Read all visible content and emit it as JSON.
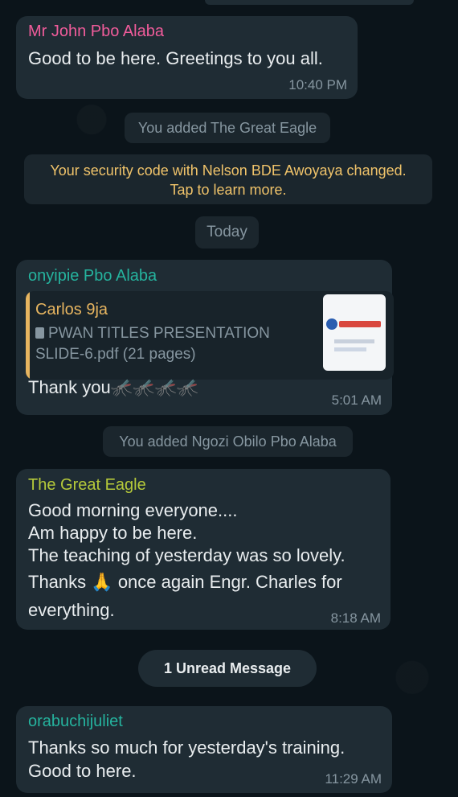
{
  "messages": {
    "m1": {
      "sender": "Mr John Pbo Alaba",
      "sender_color": "#f15c9b",
      "text": "Good to be here.  Greetings to you all.",
      "time": "10:40 PM"
    },
    "sys_added_eagle": "You added The Great Eagle",
    "security": {
      "line1": "Your security code with Nelson BDE Awoyaya changed.",
      "line2": "Tap to learn more."
    },
    "date_today": "Today",
    "m2": {
      "sender": "onyipie Pbo Alaba",
      "sender_color": "#25b39e",
      "quote": {
        "author": "Carlos 9ja",
        "doc_line1": "PWAN TITLES PRESENTATION",
        "doc_line2": "SLIDE-6.pdf (21 pages)"
      },
      "text": "Thank you",
      "emoji": "🦟🦟🦟🦟",
      "time": "5:01 AM"
    },
    "sys_added_ngozi": "You added Ngozi Obilo Pbo Alaba",
    "m3": {
      "sender": "The Great Eagle",
      "sender_color": "#b5c93a",
      "lines": [
        "Good morning everyone....",
        "Am happy to be here.",
        "The teaching of yesterday was so lovely."
      ],
      "line4_a": "Thanks",
      "line4_emoji": "🙏",
      "line4_b": "once again Engr. Charles for",
      "line5": "everything.",
      "time": "8:18 AM"
    },
    "unread": "1 Unread Message",
    "m4": {
      "sender": "orabuchijuliet",
      "sender_color": "#25b39e",
      "lines": [
        "Thanks so much for yesterday's training.",
        "Good to here."
      ],
      "time": "11:29 AM"
    }
  }
}
